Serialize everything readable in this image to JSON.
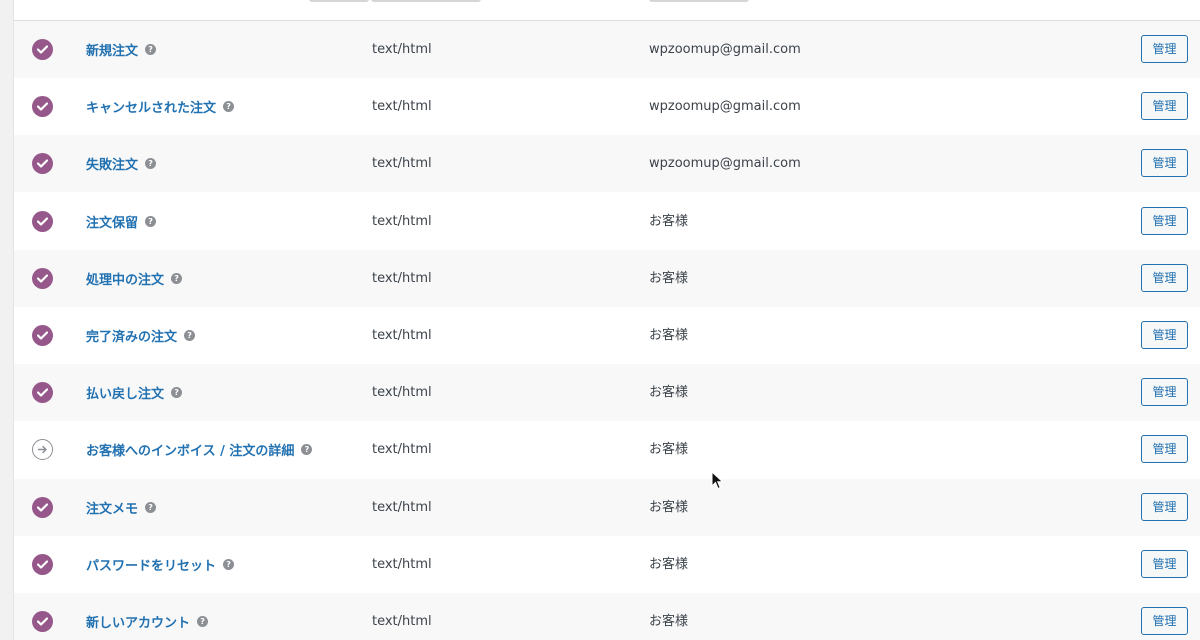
{
  "colors": {
    "accent_purple": "#96588a",
    "link_blue": "#2271b1",
    "text_gray": "#3c434a",
    "icon_gray": "#8c8f94"
  },
  "help_glyph": "?",
  "rows": [
    {
      "name": "新規注文",
      "type": "text/html",
      "recipient": "wpzoomup@gmail.com",
      "status": "enabled",
      "manage": "管理"
    },
    {
      "name": "キャンセルされた注文",
      "type": "text/html",
      "recipient": "wpzoomup@gmail.com",
      "status": "enabled",
      "manage": "管理"
    },
    {
      "name": "失敗注文",
      "type": "text/html",
      "recipient": "wpzoomup@gmail.com",
      "status": "enabled",
      "manage": "管理"
    },
    {
      "name": "注文保留",
      "type": "text/html",
      "recipient": "お客様",
      "status": "enabled",
      "manage": "管理"
    },
    {
      "name": "処理中の注文",
      "type": "text/html",
      "recipient": "お客様",
      "status": "enabled",
      "manage": "管理"
    },
    {
      "name": "完了済みの注文",
      "type": "text/html",
      "recipient": "お客様",
      "status": "enabled",
      "manage": "管理"
    },
    {
      "name": "払い戻し注文",
      "type": "text/html",
      "recipient": "お客様",
      "status": "enabled",
      "manage": "管理"
    },
    {
      "name": "お客様へのインボイス / 注文の詳細",
      "type": "text/html",
      "recipient": "お客様",
      "status": "manual",
      "manage": "管理"
    },
    {
      "name": "注文メモ",
      "type": "text/html",
      "recipient": "お客様",
      "status": "enabled",
      "manage": "管理"
    },
    {
      "name": "パスワードをリセット",
      "type": "text/html",
      "recipient": "お客様",
      "status": "enabled",
      "manage": "管理"
    },
    {
      "name": "新しいアカウント",
      "type": "text/html",
      "recipient": "お客様",
      "status": "enabled",
      "manage": "管理"
    }
  ]
}
